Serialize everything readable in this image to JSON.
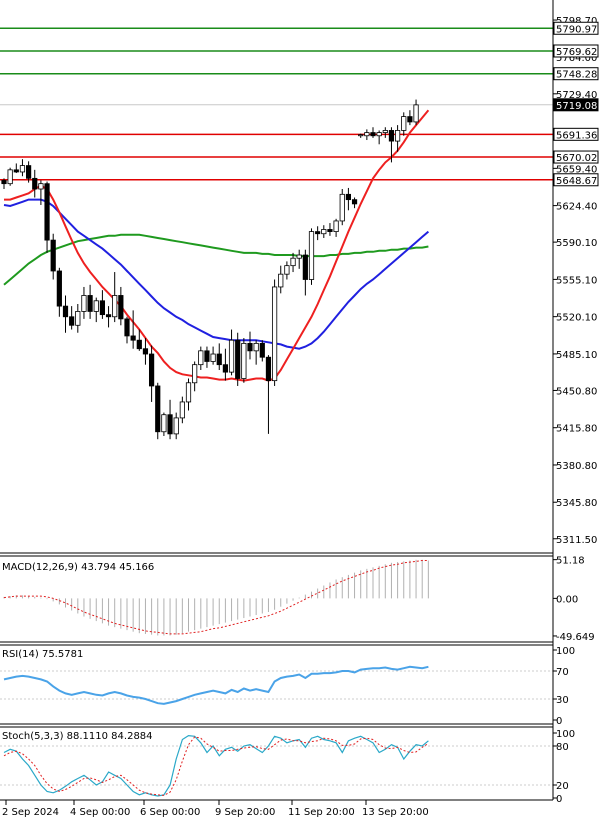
{
  "chart_data": [
    {
      "type": "candlestick",
      "panel": "price",
      "y_ticks": [
        "5798.70",
        "5764.00",
        "5729.40",
        "5694.70",
        "5659.40",
        "5624.40",
        "5590.10",
        "5555.10",
        "5520.10",
        "5485.10",
        "5450.80",
        "5415.80",
        "5380.80",
        "5345.80",
        "5311.50"
      ],
      "ylim": [
        5300,
        5810
      ],
      "x_labels": [
        "2 Sep 2024",
        "4 Sep 00:00",
        "6 Sep 00:00",
        "9 Sep 20:00",
        "11 Sep 20:00",
        "13 Sep 20:00"
      ],
      "current_price": {
        "label": "5719.08",
        "value": 5719.08
      },
      "levels": [
        {
          "label": "5790.97",
          "value": 5790.97,
          "color": "#1a8c1a"
        },
        {
          "label": "5769.62",
          "value": 5769.62,
          "color": "#1a8c1a"
        },
        {
          "label": "5748.28",
          "value": 5748.28,
          "color": "#1a8c1a"
        },
        {
          "label": "5691.36",
          "value": 5691.36,
          "color": "#e00000"
        },
        {
          "label": "5670.02",
          "value": 5670.02,
          "color": "#e00000"
        },
        {
          "label": "5648.67",
          "value": 5648.67,
          "color": "#e00000"
        }
      ],
      "candles": [
        [
          5648,
          5650,
          5640,
          5645
        ],
        [
          5645,
          5660,
          5643,
          5658
        ],
        [
          5658,
          5664,
          5655,
          5656
        ],
        [
          5656,
          5668,
          5652,
          5662
        ],
        [
          5662,
          5666,
          5646,
          5650
        ],
        [
          5650,
          5658,
          5632,
          5640
        ],
        [
          5640,
          5648,
          5625,
          5645
        ],
        [
          5645,
          5647,
          5580,
          5592
        ],
        [
          5592,
          5598,
          5555,
          5563
        ],
        [
          5563,
          5566,
          5520,
          5530
        ],
        [
          5530,
          5540,
          5505,
          5520
        ],
        [
          5520,
          5530,
          5508,
          5512
        ],
        [
          5512,
          5532,
          5505,
          5525
        ],
        [
          5525,
          5548,
          5518,
          5540
        ],
        [
          5540,
          5550,
          5518,
          5525
        ],
        [
          5525,
          5538,
          5515,
          5535
        ],
        [
          5535,
          5545,
          5518,
          5522
        ],
        [
          5522,
          5530,
          5510,
          5520
        ],
        [
          5520,
          5562,
          5515,
          5540
        ],
        [
          5540,
          5548,
          5512,
          5518
        ],
        [
          5518,
          5520,
          5495,
          5502
        ],
        [
          5502,
          5526,
          5490,
          5498
        ],
        [
          5498,
          5508,
          5488,
          5490
        ],
        [
          5490,
          5500,
          5475,
          5485
        ],
        [
          5485,
          5493,
          5440,
          5455
        ],
        [
          5455,
          5458,
          5405,
          5412
        ],
        [
          5412,
          5430,
          5408,
          5428
        ],
        [
          5428,
          5442,
          5405,
          5410
        ],
        [
          5410,
          5430,
          5405,
          5425
        ],
        [
          5425,
          5445,
          5420,
          5440
        ],
        [
          5440,
          5462,
          5432,
          5458
        ],
        [
          5458,
          5478,
          5450,
          5475
        ],
        [
          5475,
          5492,
          5470,
          5488
        ],
        [
          5488,
          5492,
          5472,
          5478
        ],
        [
          5478,
          5492,
          5475,
          5485
        ],
        [
          5485,
          5495,
          5470,
          5475
        ],
        [
          5475,
          5490,
          5460,
          5468
        ],
        [
          5468,
          5508,
          5465,
          5498
        ],
        [
          5498,
          5505,
          5455,
          5462
        ],
        [
          5462,
          5500,
          5458,
          5495
        ],
        [
          5495,
          5506,
          5480,
          5488
        ],
        [
          5488,
          5498,
          5475,
          5495
        ],
        [
          5495,
          5498,
          5478,
          5482
        ],
        [
          5482,
          5484,
          5410,
          5460
        ],
        [
          5460,
          5555,
          5455,
          5548
        ],
        [
          5548,
          5568,
          5542,
          5560
        ],
        [
          5560,
          5572,
          5555,
          5568
        ],
        [
          5568,
          5580,
          5562,
          5575
        ],
        [
          5575,
          5583,
          5565,
          5578
        ],
        [
          5578,
          5583,
          5540,
          5555
        ],
        [
          5555,
          5603,
          5550,
          5600
        ],
        [
          5600,
          5605,
          5592,
          5598
        ],
        [
          5598,
          5606,
          5594,
          5602
        ],
        [
          5602,
          5608,
          5596,
          5600
        ],
        [
          5600,
          5612,
          5595,
          5610
        ],
        [
          5610,
          5640,
          5606,
          5635
        ],
        [
          5635,
          5641,
          5620,
          5630
        ],
        [
          5630,
          5632,
          5622,
          5626
        ],
        [
          5690,
          5692,
          5688,
          5691
        ],
        [
          5690,
          5696,
          5686,
          5693
        ],
        [
          5693,
          5698,
          5688,
          5690
        ],
        [
          5690,
          5695,
          5682,
          5693
        ],
        [
          5693,
          5698,
          5688,
          5695
        ],
        [
          5695,
          5698,
          5665,
          5685
        ],
        [
          5685,
          5700,
          5675,
          5695
        ],
        [
          5695,
          5712,
          5690,
          5708
        ],
        [
          5708,
          5714,
          5700,
          5703
        ],
        [
          5703,
          5724,
          5700,
          5719
        ]
      ],
      "ema_red": [
        5630,
        5630,
        5632,
        5634,
        5636,
        5640,
        5643,
        5640,
        5630,
        5618,
        5605,
        5592,
        5580,
        5570,
        5562,
        5555,
        5548,
        5542,
        5536,
        5530,
        5522,
        5515,
        5508,
        5500,
        5492,
        5486,
        5478,
        5472,
        5468,
        5466,
        5465,
        5464,
        5463,
        5463,
        5462,
        5461,
        5461,
        5462,
        5461,
        5460,
        5461,
        5462,
        5462,
        5460,
        5462,
        5470,
        5480,
        5490,
        5500,
        5510,
        5520,
        5532,
        5545,
        5558,
        5572,
        5586,
        5600,
        5613,
        5626,
        5638,
        5650,
        5658,
        5665,
        5670,
        5676,
        5684,
        5693,
        5700,
        5707,
        5714
      ],
      "ema_blue": [
        5625,
        5624,
        5626,
        5628,
        5630,
        5630,
        5630,
        5628,
        5624,
        5618,
        5612,
        5606,
        5600,
        5596,
        5592,
        5588,
        5584,
        5579,
        5574,
        5569,
        5563,
        5557,
        5551,
        5545,
        5539,
        5533,
        5528,
        5524,
        5520,
        5517,
        5513,
        5510,
        5507,
        5504,
        5501,
        5500,
        5499,
        5498,
        5498,
        5498,
        5498,
        5498,
        5497,
        5496,
        5495,
        5494,
        5492,
        5491,
        5490,
        5492,
        5495,
        5500,
        5506,
        5513,
        5520,
        5527,
        5534,
        5540,
        5546,
        5551,
        5555,
        5560,
        5565,
        5570,
        5575,
        5580,
        5585,
        5590,
        5595,
        5600
      ],
      "ema_green": [
        5550,
        5555,
        5560,
        5565,
        5570,
        5574,
        5578,
        5581,
        5583,
        5585,
        5587,
        5589,
        5591,
        5592,
        5593,
        5594,
        5595,
        5596,
        5596,
        5597,
        5597,
        5597,
        5597,
        5596,
        5595,
        5594,
        5593,
        5592,
        5591,
        5590,
        5589,
        5588,
        5587,
        5586,
        5585,
        5584,
        5583,
        5582,
        5581,
        5580,
        5580,
        5580,
        5579,
        5579,
        5578,
        5578,
        5578,
        5578,
        5577,
        5577,
        5577,
        5577,
        5577,
        5578,
        5578,
        5579,
        5579,
        5580,
        5580,
        5581,
        5581,
        5582,
        5582,
        5583,
        5583,
        5584,
        5584,
        5585,
        5585,
        5586
      ]
    },
    {
      "type": "histogram",
      "panel": "macd",
      "label": "MACD(12,26,9) 43.794 45.166",
      "y_ticks": [
        "51.18",
        "0.00",
        "-49.649"
      ],
      "ylim": [
        -55,
        56
      ],
      "histogram": [
        2,
        3,
        4,
        4,
        3,
        2,
        1,
        -1,
        -4,
        -8,
        -12,
        -16,
        -20,
        -24,
        -27,
        -30,
        -33,
        -36,
        -38,
        -40,
        -42,
        -44,
        -46,
        -47,
        -48,
        -49,
        -49,
        -49,
        -48,
        -46,
        -44,
        -42,
        -40,
        -38,
        -36,
        -34,
        -32,
        -30,
        -28,
        -26,
        -24,
        -22,
        -20,
        -18,
        -15,
        -11,
        -7,
        -3,
        1,
        5,
        9,
        13,
        17,
        21,
        25,
        28,
        31,
        34,
        37,
        39,
        41,
        43,
        45,
        47,
        48,
        49,
        50,
        51,
        51,
        50
      ],
      "signal": [
        1,
        2,
        3,
        3,
        3,
        3,
        3,
        2,
        0,
        -3,
        -6,
        -10,
        -14,
        -18,
        -21,
        -24,
        -27,
        -30,
        -33,
        -35,
        -37,
        -39,
        -41,
        -43,
        -44,
        -45,
        -46,
        -47,
        -47,
        -47,
        -46,
        -45,
        -44,
        -42,
        -40,
        -39,
        -37,
        -35,
        -33,
        -31,
        -29,
        -27,
        -25,
        -23,
        -20,
        -17,
        -13,
        -9,
        -5,
        -1,
        3,
        7,
        11,
        15,
        19,
        23,
        26,
        29,
        32,
        35,
        37,
        40,
        42,
        44,
        45,
        47,
        48,
        49,
        50,
        50
      ]
    },
    {
      "type": "line",
      "panel": "rsi",
      "label": "RSI(14) 75.5781",
      "y_ticks": [
        "100",
        "70",
        "30",
        "0"
      ],
      "ylim": [
        0,
        100
      ],
      "values": [
        58,
        60,
        62,
        63,
        62,
        60,
        58,
        55,
        48,
        42,
        38,
        36,
        38,
        40,
        38,
        36,
        35,
        38,
        40,
        38,
        35,
        33,
        32,
        30,
        27,
        24,
        23,
        25,
        27,
        30,
        33,
        36,
        38,
        40,
        42,
        40,
        38,
        43,
        40,
        45,
        42,
        44,
        42,
        40,
        55,
        60,
        62,
        63,
        65,
        60,
        66,
        66,
        67,
        67,
        68,
        70,
        70,
        68,
        72,
        73,
        74,
        74,
        75,
        73,
        72,
        74,
        76,
        75,
        74,
        76
      ]
    },
    {
      "type": "line",
      "panel": "stoch",
      "label": "Stoch(5,3,3) 88.1110 84.2884",
      "y_ticks": [
        "100",
        "80",
        "20",
        "0"
      ],
      "ylim": [
        0,
        100
      ],
      "k": [
        70,
        75,
        72,
        60,
        50,
        35,
        20,
        10,
        8,
        12,
        18,
        25,
        30,
        35,
        28,
        20,
        25,
        40,
        35,
        30,
        20,
        10,
        5,
        8,
        5,
        3,
        5,
        20,
        60,
        90,
        96,
        95,
        85,
        70,
        80,
        65,
        75,
        78,
        72,
        80,
        82,
        76,
        70,
        80,
        95,
        92,
        85,
        88,
        90,
        78,
        92,
        95,
        90,
        88,
        85,
        70,
        88,
        92,
        95,
        90,
        85,
        70,
        75,
        82,
        78,
        60,
        72,
        82,
        80,
        88
      ],
      "d": [
        65,
        70,
        72,
        68,
        60,
        50,
        35,
        22,
        14,
        10,
        13,
        18,
        24,
        30,
        31,
        28,
        24,
        28,
        33,
        35,
        28,
        20,
        12,
        8,
        6,
        5,
        4,
        9,
        28,
        57,
        82,
        94,
        92,
        83,
        78,
        72,
        73,
        73,
        75,
        77,
        78,
        79,
        76,
        75,
        82,
        89,
        91,
        88,
        88,
        85,
        87,
        88,
        92,
        91,
        88,
        81,
        81,
        83,
        91,
        92,
        90,
        82,
        77,
        76,
        78,
        73,
        70,
        71,
        78,
        84
      ]
    }
  ]
}
